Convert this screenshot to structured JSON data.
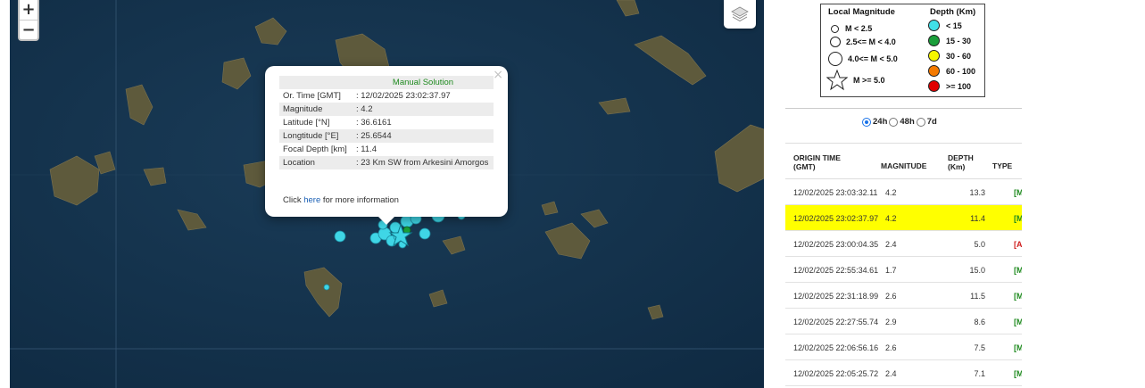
{
  "map": {
    "zoom_in_label": "+",
    "zoom_out_label": "−",
    "popup": {
      "close_label": "×",
      "title": "Manual Solution",
      "rows": [
        {
          "key": "Or. Time [GMT]",
          "value": ": 12/02/2025 23:02:37.97"
        },
        {
          "key": "Magnitude",
          "value": ": 4.2"
        },
        {
          "key": "Latitude [°N]",
          "value": ": 36.6161"
        },
        {
          "key": "Longtitude [°E]",
          "value": ": 25.6544"
        },
        {
          "key": "Focal Depth [km]",
          "value": ": 11.4"
        },
        {
          "key": "Location",
          "value": ": 23 Km SW from Arkesini Amorgos"
        }
      ],
      "click_prefix": "Click ",
      "click_link": "here",
      "click_suffix": " for more information"
    }
  },
  "legend": {
    "magnitude_header": "Local Magnitude",
    "depth_header": "Depth (Km)",
    "magnitudes": [
      "M < 2.5",
      "2.5<= M < 4.0",
      "4.0<= M < 5.0",
      "M >= 5.0"
    ],
    "depths": [
      {
        "label": "< 15",
        "color": "#40e0e8"
      },
      {
        "label": "15 - 30",
        "color": "#1a9e3a"
      },
      {
        "label": "30 - 60",
        "color": "#f5f500"
      },
      {
        "label": "60 - 100",
        "color": "#f57a00"
      },
      {
        "label": ">= 100",
        "color": "#e00000"
      }
    ]
  },
  "range": {
    "options": [
      "24h",
      "48h",
      "7d"
    ],
    "selected": "24h"
  },
  "table": {
    "headers": {
      "time": "ORIGIN TIME (GMT)",
      "magnitude": "MAGNITUDE",
      "depth": "DEPTH (Km)",
      "type": "TYPE"
    },
    "rows": [
      {
        "time": "12/02/2025 23:03:32.11",
        "magnitude": "4.2",
        "depth": "13.3",
        "type": "[M",
        "type_color": "#1f8a1f",
        "selected": false
      },
      {
        "time": "12/02/2025 23:02:37.97",
        "magnitude": "4.2",
        "depth": "11.4",
        "type": "[M",
        "type_color": "#1f8a1f",
        "selected": true
      },
      {
        "time": "12/02/2025 23:00:04.35",
        "magnitude": "2.4",
        "depth": "5.0",
        "type": "[A",
        "type_color": "#d02020",
        "selected": false
      },
      {
        "time": "12/02/2025 22:55:34.61",
        "magnitude": "1.7",
        "depth": "15.0",
        "type": "[M",
        "type_color": "#1f8a1f",
        "selected": false
      },
      {
        "time": "12/02/2025 22:31:18.99",
        "magnitude": "2.6",
        "depth": "11.5",
        "type": "[M",
        "type_color": "#1f8a1f",
        "selected": false
      },
      {
        "time": "12/02/2025 22:27:55.74",
        "magnitude": "2.9",
        "depth": "8.6",
        "type": "[M",
        "type_color": "#1f8a1f",
        "selected": false
      },
      {
        "time": "12/02/2025 22:06:56.16",
        "magnitude": "2.6",
        "depth": "7.5",
        "type": "[M",
        "type_color": "#1f8a1f",
        "selected": false
      },
      {
        "time": "12/02/2025 22:05:25.72",
        "magnitude": "2.4",
        "depth": "7.1",
        "type": "[M",
        "type_color": "#1f8a1f",
        "selected": false
      }
    ]
  }
}
